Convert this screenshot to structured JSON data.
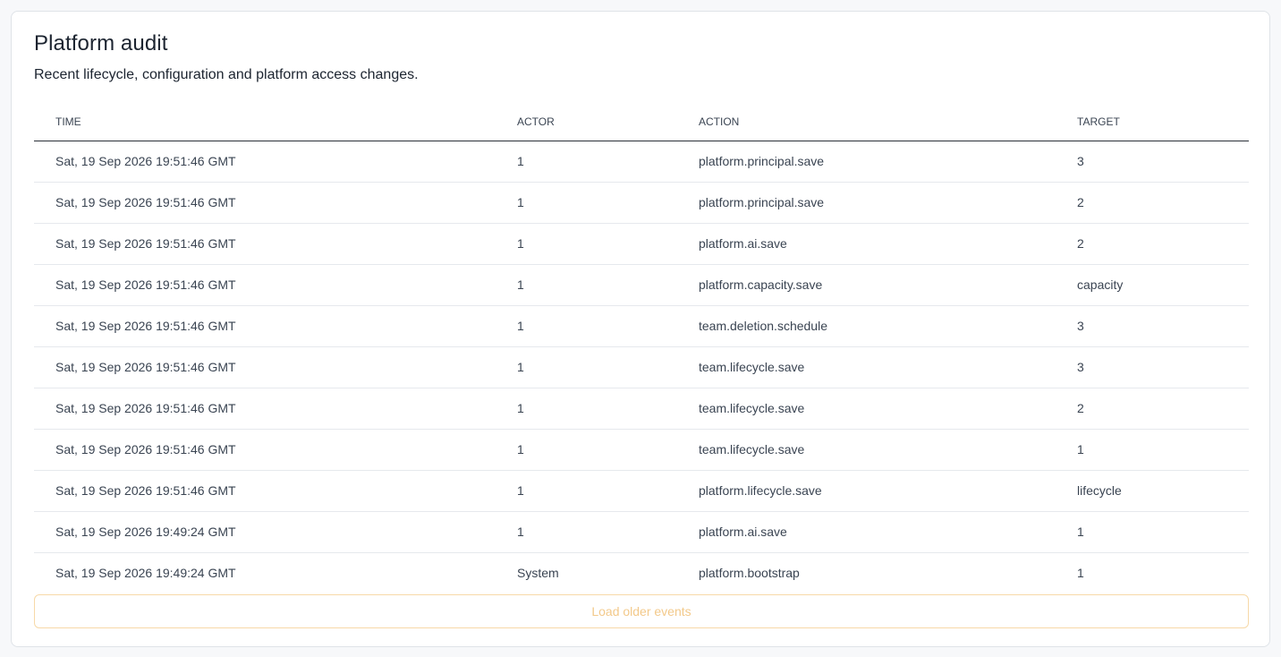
{
  "panel": {
    "title": "Platform audit",
    "subtitle": "Recent lifecycle, configuration and platform access changes."
  },
  "table": {
    "headers": {
      "time": "TIME",
      "actor": "ACTOR",
      "action": "ACTION",
      "target": "TARGET"
    },
    "rows": [
      {
        "time": "Sat, 19 Sep 2026 19:51:46 GMT",
        "actor": "1",
        "action": "platform.principal.save",
        "target": "3"
      },
      {
        "time": "Sat, 19 Sep 2026 19:51:46 GMT",
        "actor": "1",
        "action": "platform.principal.save",
        "target": "2"
      },
      {
        "time": "Sat, 19 Sep 2026 19:51:46 GMT",
        "actor": "1",
        "action": "platform.ai.save",
        "target": "2"
      },
      {
        "time": "Sat, 19 Sep 2026 19:51:46 GMT",
        "actor": "1",
        "action": "platform.capacity.save",
        "target": "capacity"
      },
      {
        "time": "Sat, 19 Sep 2026 19:51:46 GMT",
        "actor": "1",
        "action": "team.deletion.schedule",
        "target": "3"
      },
      {
        "time": "Sat, 19 Sep 2026 19:51:46 GMT",
        "actor": "1",
        "action": "team.lifecycle.save",
        "target": "3"
      },
      {
        "time": "Sat, 19 Sep 2026 19:51:46 GMT",
        "actor": "1",
        "action": "team.lifecycle.save",
        "target": "2"
      },
      {
        "time": "Sat, 19 Sep 2026 19:51:46 GMT",
        "actor": "1",
        "action": "team.lifecycle.save",
        "target": "1"
      },
      {
        "time": "Sat, 19 Sep 2026 19:51:46 GMT",
        "actor": "1",
        "action": "platform.lifecycle.save",
        "target": "lifecycle"
      },
      {
        "time": "Sat, 19 Sep 2026 19:49:24 GMT",
        "actor": "1",
        "action": "platform.ai.save",
        "target": "1"
      },
      {
        "time": "Sat, 19 Sep 2026 19:49:24 GMT",
        "actor": "System",
        "action": "platform.bootstrap",
        "target": "1"
      }
    ]
  },
  "load_more": {
    "label": "Load older events",
    "border_color": "#f7d9a8",
    "text_color": "#f3c98a"
  }
}
